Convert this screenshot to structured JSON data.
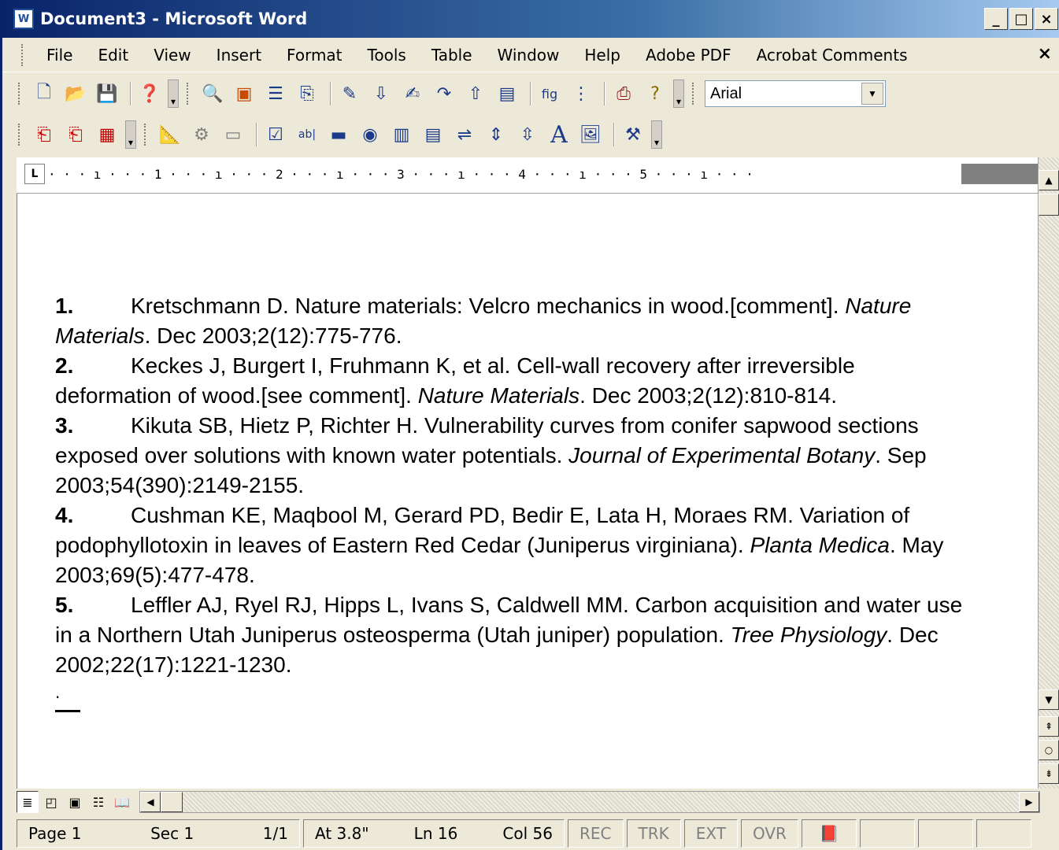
{
  "window": {
    "title": "Document3 - Microsoft Word",
    "app_icon": "W",
    "caption_buttons": [
      "_",
      "□",
      "×"
    ]
  },
  "menu": {
    "items": [
      "File",
      "Edit",
      "View",
      "Insert",
      "Format",
      "Tools",
      "Table",
      "Window",
      "Help",
      "Adobe PDF",
      "Acrobat Comments"
    ],
    "close": "×"
  },
  "standard_toolbar": {
    "font": "Arial"
  },
  "ruler": {
    "numbers": "· · · ı · · · 1 · · · ı · · · 2 · · · ı · · · 3 · · · ı · · · 4 · · · ı · · · 5 · · · ı · · ·"
  },
  "document": {
    "references": [
      {
        "num": "1.",
        "text": "Kretschmann D. Nature materials: Velcro mechanics in wood.[comment]. ",
        "journal": "Nature Materials",
        "rest": ". Dec 2003;2(12):775-776."
      },
      {
        "num": "2.",
        "text": "Keckes J, Burgert I, Fruhmann K, et al. Cell-wall recovery after irreversible deformation of wood.[see comment]. ",
        "journal": "Nature Materials",
        "rest": ". Dec 2003;2(12):810-814."
      },
      {
        "num": "3.",
        "text": "Kikuta SB, Hietz P, Richter H. Vulnerability curves from conifer sapwood sections exposed over solutions with known water potentials. ",
        "journal": "Journal of Experimental Botany",
        "rest": ". Sep 2003;54(390):2149-2155."
      },
      {
        "num": "4.",
        "text": "Cushman KE, Maqbool M, Gerard PD, Bedir E, Lata H, Moraes RM. Variation of podophyllotoxin in leaves of Eastern Red Cedar (Juniperus virginiana). ",
        "journal": "Planta Medica",
        "rest": ". May 2003;69(5):477-478."
      },
      {
        "num": "5.",
        "text": "Leffler AJ, Ryel RJ, Hipps L, Ivans S, Caldwell MM. Carbon acquisition and water use in a Northern Utah Juniperus osteosperma (Utah juniper) population. ",
        "journal": "Tree Physiology",
        "rest": ". Dec 2002;22(17):1221-1230."
      }
    ],
    "trailing": "."
  },
  "status": {
    "page": "Page 1",
    "sec": "Sec 1",
    "pages": "1/1",
    "at": "At 3.8\"",
    "ln": "Ln 16",
    "col": "Col 56",
    "rec": "REC",
    "trk": "TRK",
    "ext": "EXT",
    "ovr": "OVR"
  },
  "icons": {
    "standard": [
      "new-doc-icon",
      "open-icon",
      "save-icon",
      "help-icon",
      "zoom-icon",
      "image-icon",
      "list-icon",
      "insert-icon",
      "draw-icon",
      "download-icon",
      "edit-icon",
      "redo-icon",
      "upload-icon",
      "doc-icon",
      "figure-icon",
      "numbered-list-icon",
      "print-preview-icon",
      "question-icon"
    ],
    "forms": [
      "pdf-icon",
      "pdf-icon-2",
      "pdf-comment-icon",
      "design-mode-icon",
      "properties-icon",
      "view-code-icon",
      "checkbox-icon",
      "textbox-icon",
      "button-icon",
      "radio-icon",
      "listbox-icon",
      "combobox-icon",
      "toggle-icon",
      "spin-icon",
      "scrollbar-icon",
      "label-icon",
      "image-control-icon",
      "more-controls-icon"
    ]
  }
}
